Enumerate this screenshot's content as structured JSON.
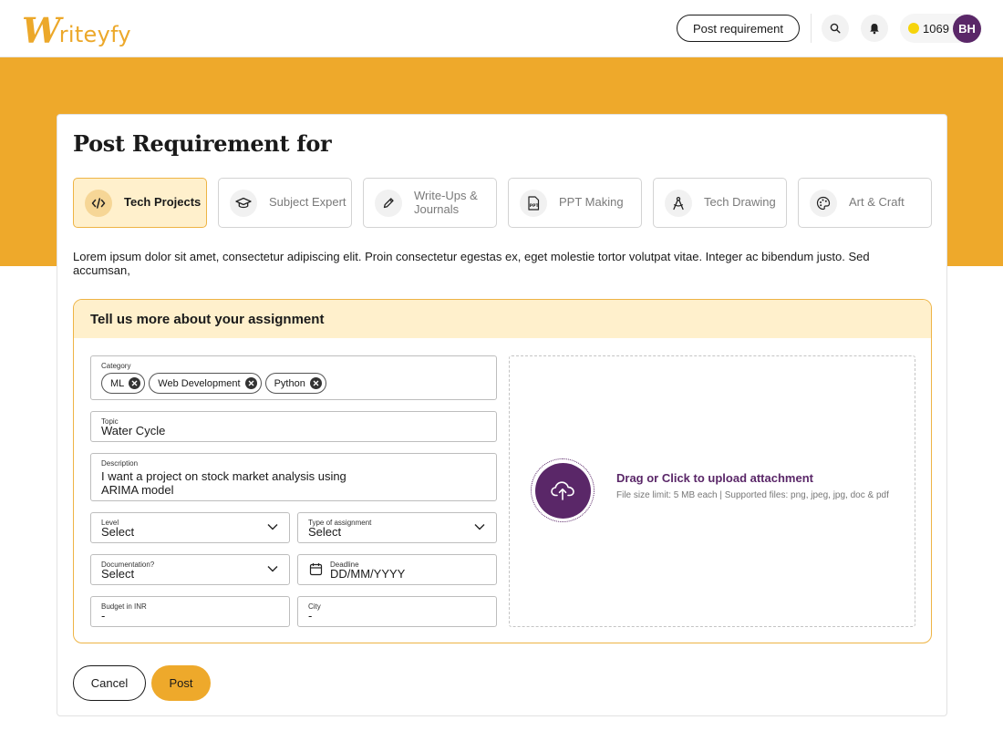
{
  "header": {
    "logo_mark": "W",
    "logo_text": "riteyfy",
    "post_requirement_label": "Post requirement",
    "coins": "1069",
    "avatar_initials": "BH",
    "icons": [
      "search-icon",
      "bell-icon",
      "coin-icon"
    ]
  },
  "page": {
    "title": "Post Requirement for",
    "intro": "Lorem ipsum dolor sit amet, consectetur adipiscing elit. Proin consectetur egestas ex, eget molestie tortor volutpat vitae. Integer ac bibendum justo. Sed accumsan,"
  },
  "tabs": [
    {
      "label": "Tech Projects",
      "icon": "code-icon",
      "active": true
    },
    {
      "label": "Subject Expert",
      "icon": "graduation-cap-icon",
      "active": false
    },
    {
      "label": "Write-Ups & Journals",
      "icon": "pencil-icon",
      "active": false
    },
    {
      "label": "PPT Making",
      "icon": "ppt-icon",
      "active": false
    },
    {
      "label": "Tech Drawing",
      "icon": "compass-icon",
      "active": false
    },
    {
      "label": "Art & Craft",
      "icon": "palette-icon",
      "active": false
    }
  ],
  "form": {
    "heading": "Tell us more about your assignment",
    "category": {
      "label": "Category",
      "chips": [
        "ML",
        "Web Development",
        "Python"
      ]
    },
    "topic": {
      "label": "Topic",
      "value": "Water Cycle"
    },
    "description": {
      "label": "Description",
      "value_line1": "I want a project on stock market analysis using",
      "value_line2": "ARIMA model"
    },
    "level": {
      "label": "Level",
      "value": "Select"
    },
    "assignment_type": {
      "label": "Type of assignment",
      "value": "Select"
    },
    "documentation": {
      "label": "Documentation?",
      "value": "Select"
    },
    "deadline": {
      "label": "Deadline",
      "value": "DD/MM/YYYY"
    },
    "budget": {
      "label": "Budget in INR",
      "value": "-"
    },
    "city": {
      "label": "City",
      "value": "-"
    },
    "upload": {
      "title": "Drag or Click to upload attachment",
      "subtitle": "File size limit: 5 MB each |  Supported files: png, jpeg, jpg, doc & pdf"
    }
  },
  "actions": {
    "cancel": "Cancel",
    "post": "Post"
  },
  "colors": {
    "accent": "#eea92b",
    "brand_purple": "#5a2768",
    "tab_active_bg": "#fff0cc"
  }
}
